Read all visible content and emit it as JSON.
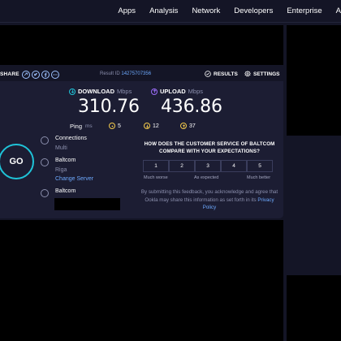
{
  "nav": {
    "items": [
      "Apps",
      "Analysis",
      "Network",
      "Developers",
      "Enterprise",
      "A"
    ]
  },
  "share": {
    "label": "SHARE",
    "icons": [
      "link-icon",
      "twitter-icon",
      "facebook-icon",
      "more-icon"
    ]
  },
  "result": {
    "label": "Result ID",
    "id": "14275707356"
  },
  "header_buttons": {
    "results": "RESULTS",
    "settings": "SETTINGS"
  },
  "download": {
    "label": "DOWNLOAD",
    "unit": "Mbps",
    "value": "310.76"
  },
  "upload": {
    "label": "UPLOAD",
    "unit": "Mbps",
    "value": "436.86"
  },
  "ping": {
    "label": "Ping",
    "unit": "ms",
    "idle": "5",
    "download": "12",
    "upload": "37"
  },
  "go_button": "GO",
  "connections": {
    "title": "Connections",
    "value": "Multi"
  },
  "server": {
    "name": "Baltcom",
    "city": "Riga",
    "change_label": "Change Server"
  },
  "provider": {
    "name": "Baltcom"
  },
  "feedback": {
    "question": "HOW DOES THE CUSTOMER SERVICE OF BALTCOM COMPARE WITH YOUR EXPECTATIONS?",
    "ratings": [
      "1",
      "2",
      "3",
      "4",
      "5"
    ],
    "scale_low": "Much worse",
    "scale_mid": "As expected",
    "scale_high": "Much better",
    "disclaimer": "By submitting this feedback, you acknowledge and agree that Ookla may share this information as set forth in its",
    "policy_link": "Privacy Policy"
  },
  "colors": {
    "background": "#141526",
    "panel": "#1c1d33",
    "accent_cyan": "#1fc3d8",
    "accent_purple": "#9b6cf7",
    "link": "#6eaaff"
  }
}
